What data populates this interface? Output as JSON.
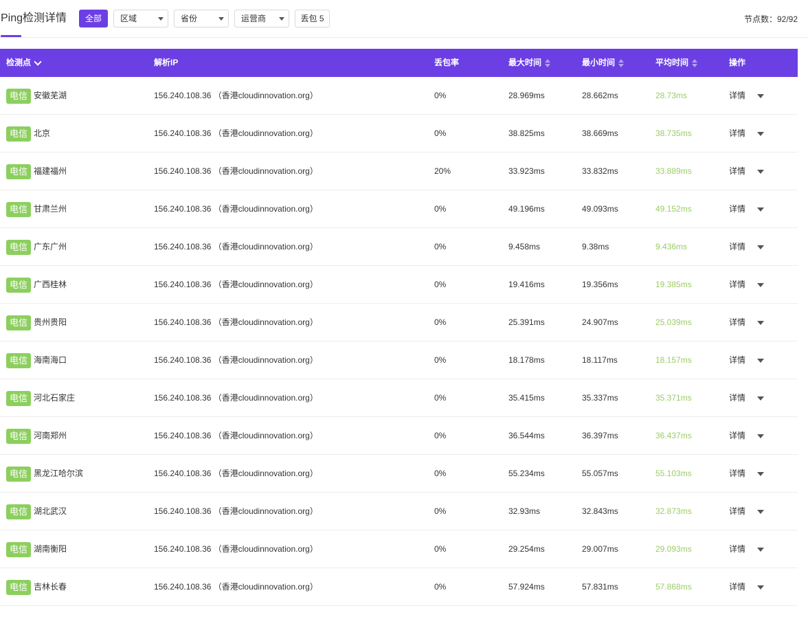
{
  "header": {
    "title": "Ping检测详情",
    "filters": {
      "all_label": "全部",
      "region": "区域",
      "province": "省份",
      "isp": "运营商",
      "packet_loss": "丢包 5"
    },
    "node_count": "节点数：92/92"
  },
  "table": {
    "columns": {
      "node": "检测点",
      "ip": "解析IP",
      "loss": "丢包率",
      "max": "最大时间",
      "min": "最小时间",
      "avg": "平均时间",
      "action": "操作"
    },
    "rows": [
      {
        "isp": "电信",
        "location": "安徽芜湖",
        "ip": "156.240.108.36 （香港cloudinnovation.org）",
        "loss": "0%",
        "max": "28.969ms",
        "min": "28.662ms",
        "avg": "28.73ms",
        "action": "详情"
      },
      {
        "isp": "电信",
        "location": "北京",
        "ip": "156.240.108.36 （香港cloudinnovation.org）",
        "loss": "0%",
        "max": "38.825ms",
        "min": "38.669ms",
        "avg": "38.735ms",
        "action": "详情"
      },
      {
        "isp": "电信",
        "location": "福建福州",
        "ip": "156.240.108.36 （香港cloudinnovation.org）",
        "loss": "20%",
        "max": "33.923ms",
        "min": "33.832ms",
        "avg": "33.889ms",
        "action": "详情"
      },
      {
        "isp": "电信",
        "location": "甘肃兰州",
        "ip": "156.240.108.36 （香港cloudinnovation.org）",
        "loss": "0%",
        "max": "49.196ms",
        "min": "49.093ms",
        "avg": "49.152ms",
        "action": "详情"
      },
      {
        "isp": "电信",
        "location": "广东广州",
        "ip": "156.240.108.36 （香港cloudinnovation.org）",
        "loss": "0%",
        "max": "9.458ms",
        "min": "9.38ms",
        "avg": "9.436ms",
        "action": "详情"
      },
      {
        "isp": "电信",
        "location": "广西桂林",
        "ip": "156.240.108.36 （香港cloudinnovation.org）",
        "loss": "0%",
        "max": "19.416ms",
        "min": "19.356ms",
        "avg": "19.385ms",
        "action": "详情"
      },
      {
        "isp": "电信",
        "location": "贵州贵阳",
        "ip": "156.240.108.36 （香港cloudinnovation.org）",
        "loss": "0%",
        "max": "25.391ms",
        "min": "24.907ms",
        "avg": "25.039ms",
        "action": "详情"
      },
      {
        "isp": "电信",
        "location": "海南海口",
        "ip": "156.240.108.36 （香港cloudinnovation.org）",
        "loss": "0%",
        "max": "18.178ms",
        "min": "18.117ms",
        "avg": "18.157ms",
        "action": "详情"
      },
      {
        "isp": "电信",
        "location": "河北石家庄",
        "ip": "156.240.108.36 （香港cloudinnovation.org）",
        "loss": "0%",
        "max": "35.415ms",
        "min": "35.337ms",
        "avg": "35.371ms",
        "action": "详情"
      },
      {
        "isp": "电信",
        "location": "河南郑州",
        "ip": "156.240.108.36 （香港cloudinnovation.org）",
        "loss": "0%",
        "max": "36.544ms",
        "min": "36.397ms",
        "avg": "36.437ms",
        "action": "详情"
      },
      {
        "isp": "电信",
        "location": "黑龙江哈尔滨",
        "ip": "156.240.108.36 （香港cloudinnovation.org）",
        "loss": "0%",
        "max": "55.234ms",
        "min": "55.057ms",
        "avg": "55.103ms",
        "action": "详情"
      },
      {
        "isp": "电信",
        "location": "湖北武汉",
        "ip": "156.240.108.36 （香港cloudinnovation.org）",
        "loss": "0%",
        "max": "32.93ms",
        "min": "32.843ms",
        "avg": "32.873ms",
        "action": "详情"
      },
      {
        "isp": "电信",
        "location": "湖南衡阳",
        "ip": "156.240.108.36 （香港cloudinnovation.org）",
        "loss": "0%",
        "max": "29.254ms",
        "min": "29.007ms",
        "avg": "29.093ms",
        "action": "详情"
      },
      {
        "isp": "电信",
        "location": "吉林长春",
        "ip": "156.240.108.36 （香港cloudinnovation.org）",
        "loss": "0%",
        "max": "57.924ms",
        "min": "57.831ms",
        "avg": "57.868ms",
        "action": "详情"
      }
    ]
  },
  "colors": {
    "accent": "#6b3fe4",
    "isp_tag": "#8ccf5e",
    "avg_text": "#9ccc65"
  }
}
